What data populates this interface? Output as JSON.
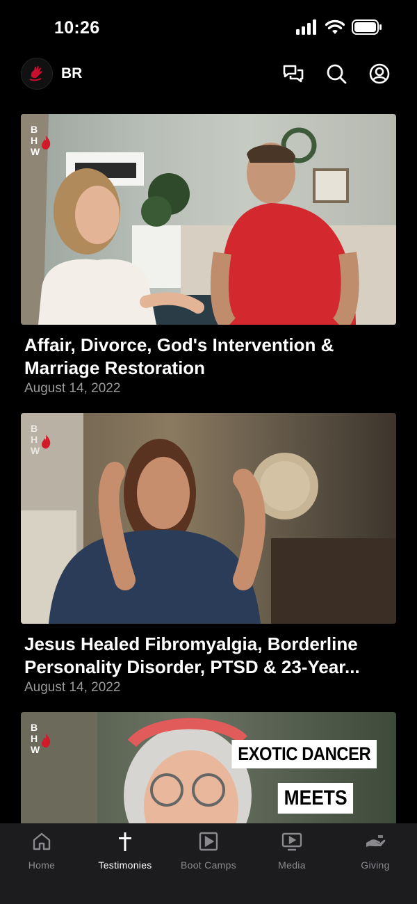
{
  "status_bar": {
    "time": "10:26"
  },
  "header": {
    "brand": "BR"
  },
  "header_icons": [
    "chat-icon",
    "search-icon",
    "profile-icon"
  ],
  "feed": [
    {
      "title": "Affair, Divorce, God's Intervention & Marriage Restoration",
      "date": "August 14, 2022",
      "watermark": "BHW"
    },
    {
      "title": "Jesus Healed Fibromyalgia, Borderline Personality Disorder, PTSD & 23-Year...",
      "date": "August 14, 2022",
      "watermark": "BHW"
    },
    {
      "title": "",
      "date": "",
      "watermark": "BHW",
      "overlay_lines": [
        "EXOTIC DANCER",
        "MEETS"
      ]
    }
  ],
  "tabs": [
    {
      "label": "Home",
      "icon": "home-icon",
      "active": false
    },
    {
      "label": "Testimonies",
      "icon": "cross-icon",
      "active": true
    },
    {
      "label": "Boot Camps",
      "icon": "play-square-icon",
      "active": false
    },
    {
      "label": "Media",
      "icon": "tv-play-icon",
      "active": false
    },
    {
      "label": "Giving",
      "icon": "giving-hand-icon",
      "active": false
    }
  ],
  "colors": {
    "background": "#000000",
    "tabbar": "#1c1c1e",
    "inactive_tab": "#8a8a8e",
    "date_text": "#9a9a9a",
    "brand_red": "#c8102e"
  }
}
